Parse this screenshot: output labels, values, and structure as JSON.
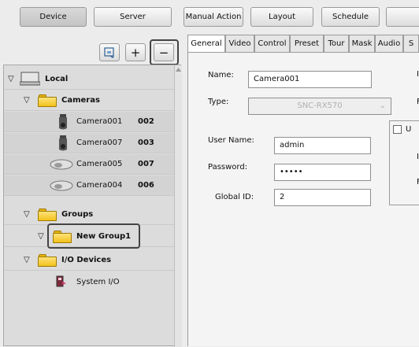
{
  "toolbar": {
    "device": "Device",
    "server": "Server",
    "manual_action": "Manual Action",
    "layout": "Layout",
    "schedule": "Schedule"
  },
  "tree_tools": {
    "plus": "+",
    "minus": "−"
  },
  "tree": {
    "local": "Local",
    "cameras": "Cameras",
    "cams": [
      {
        "name": "Camera001",
        "id": "002"
      },
      {
        "name": "Camera007",
        "id": "003"
      },
      {
        "name": "Camera005",
        "id": "007"
      },
      {
        "name": "Camera004",
        "id": "006"
      }
    ],
    "groups": "Groups",
    "new_group": "New Group1",
    "io_devices": "I/O Devices",
    "system_io": "System I/O"
  },
  "tabs": [
    "General",
    "Video",
    "Control",
    "Preset",
    "Tour",
    "Mask",
    "Audio",
    "S"
  ],
  "form": {
    "name_label": "Name:",
    "name_value": "Camera001",
    "type_label": "Type:",
    "type_value": "SNC-RX570",
    "user_label": "User Name:",
    "user_value": "admin",
    "pass_label": "Password:",
    "pass_value": "•••••",
    "gid_label": "Global ID:",
    "gid_value": "2",
    "right_i1": "I",
    "right_p1": "F",
    "right_u": "U",
    "right_i2": "I",
    "right_p2": "F"
  },
  "colors": {
    "folder": "#f2c21c",
    "highlight": "#444444"
  }
}
